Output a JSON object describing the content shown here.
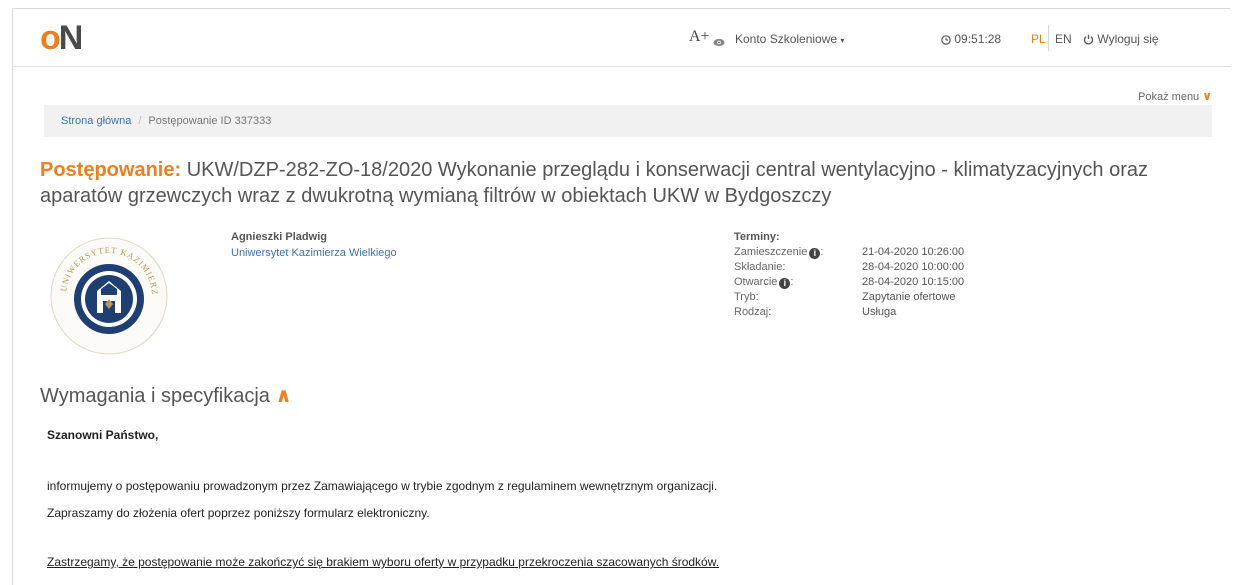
{
  "header": {
    "logo_o": "o",
    "logo_n": "N",
    "font_size_button": "A+",
    "account_label": "Konto Szkoleniowe",
    "clock_time": "09:51:28",
    "lang_pl": "PL",
    "lang_en": "EN",
    "logout_label": "Wyloguj się"
  },
  "show_menu_label": "Pokaż menu",
  "breadcrumb": {
    "home": "Strona główna",
    "separator": "/",
    "current": "Postępowanie ID 337333"
  },
  "tender": {
    "title_lead": "Postępowanie:",
    "title_text": "UKW/DZP-282-ZO-18/2020 Wykonanie przeglądu i konserwacji central wentylacyjno - klimatyzacyjnych oraz aparatów grzewczych wraz z dwukrotną wymianą filtrów w obiektach UKW w Bydgoszczy",
    "contact_name": "Agnieszki Pladwig",
    "organization": "Uniwersytet Kazimierza Wielkiego",
    "emblem_text": "UNIWERSYTET KAZIMIERZA WIELKIEGO"
  },
  "terms": {
    "heading": "Terminy:",
    "rows": [
      {
        "label": "Zamieszczenie",
        "value": "21-04-2020 10:26:00"
      },
      {
        "label": "Składanie:",
        "value": "28-04-2020 10:00:00"
      },
      {
        "label": "Otwarcie",
        "value": "28-04-2020 10:15:00"
      },
      {
        "label": "Tryb:",
        "value": "Zapytanie ofertowe"
      },
      {
        "label": "Rodzaj:",
        "value": "Usługa"
      }
    ]
  },
  "requirements": {
    "heading": "Wymagania i specyfikacja",
    "greeting": "Szanowni Państwo,",
    "paragraph1": "informujemy o postępowaniu prowadzonym przez Zamawiającego w trybie zgodnym z regulaminem wewnętrznym organizacji.",
    "paragraph2": "Zapraszamy do złożenia ofert poprzez poniższy formularz elektroniczny.",
    "notice": "Zastrzegamy, że postępowanie może zakończyć się brakiem wyboru oferty w przypadku przekroczenia szacowanych środków."
  },
  "colors": {
    "accent": "#f07d1e",
    "link": "#3a73b3",
    "emblem_blue": "#1f3f73",
    "emblem_gold": "#b49a5a"
  }
}
